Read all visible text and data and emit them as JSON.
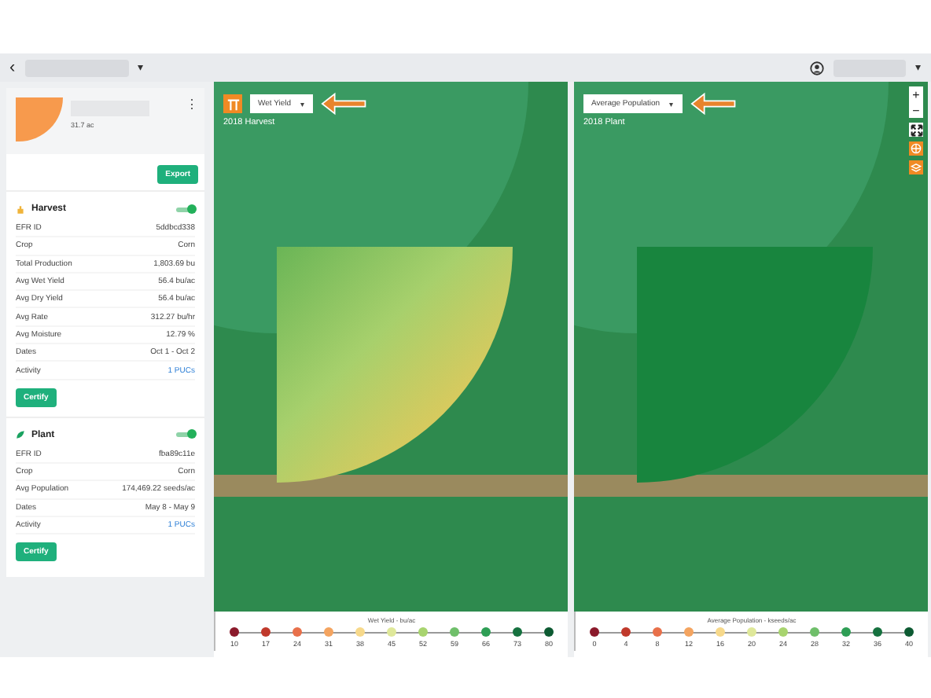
{
  "header": {
    "back": "‹",
    "caret": "▾",
    "user_caret": "▾"
  },
  "field": {
    "area": "31.7 ac",
    "menu": "⋮"
  },
  "export_button": "Export",
  "sections": [
    {
      "kind": "harvest",
      "title": "Harvest",
      "on": true,
      "rows": [
        {
          "label": "EFR ID",
          "value": "5ddbcd338",
          "link": false
        },
        {
          "label": "Crop",
          "value": "Corn",
          "link": false
        },
        {
          "label": "Total Production",
          "value": "1,803.69 bu",
          "link": false
        },
        {
          "label": "Avg Wet Yield",
          "value": "56.4 bu/ac",
          "link": false
        },
        {
          "label": "Avg Dry Yield",
          "value": "56.4 bu/ac",
          "link": false
        },
        {
          "label": "Avg Rate",
          "value": "312.27 bu/hr",
          "link": false
        },
        {
          "label": "Avg Moisture",
          "value": "12.79 %",
          "link": false
        },
        {
          "label": "Dates",
          "value": "Oct 1 - Oct 2",
          "link": false
        },
        {
          "label": "Activity",
          "value": "1 PUCs",
          "link": true
        }
      ],
      "button": "Certify"
    },
    {
      "kind": "plant",
      "title": "Plant",
      "on": true,
      "rows": [
        {
          "label": "EFR ID",
          "value": "fba89c11e",
          "link": false
        },
        {
          "label": "Crop",
          "value": "Corn",
          "link": false
        },
        {
          "label": "Avg Population",
          "value": "174,469.22 seeds/ac",
          "link": false
        },
        {
          "label": "Dates",
          "value": "May 8 - May 9",
          "link": false
        },
        {
          "label": "Activity",
          "value": "1 PUCs",
          "link": true
        }
      ],
      "button": "Certify"
    }
  ],
  "maps": [
    {
      "kind": "harvest",
      "layer": "Wet Yield",
      "caret": "▾",
      "label": "2018 Harvest",
      "legend": {
        "title": "Wet Yield - bu/ac",
        "stops": [
          {
            "value": "10",
            "color": "#8b1a2b"
          },
          {
            "value": "17",
            "color": "#c0392b"
          },
          {
            "value": "24",
            "color": "#e8704a"
          },
          {
            "value": "31",
            "color": "#f4a460"
          },
          {
            "value": "38",
            "color": "#f7d98b"
          },
          {
            "value": "45",
            "color": "#dfe89a"
          },
          {
            "value": "52",
            "color": "#a8d46f"
          },
          {
            "value": "59",
            "color": "#6fbf6a"
          },
          {
            "value": "66",
            "color": "#2e9e55"
          },
          {
            "value": "73",
            "color": "#16713f"
          },
          {
            "value": "80",
            "color": "#0d5a32"
          }
        ]
      }
    },
    {
      "kind": "plant",
      "layer": "Average Population",
      "caret": "▾",
      "label": "2018 Plant",
      "legend": {
        "title": "Average Population - kseeds/ac",
        "stops": [
          {
            "value": "0",
            "color": "#8b1a2b"
          },
          {
            "value": "4",
            "color": "#c0392b"
          },
          {
            "value": "8",
            "color": "#e8704a"
          },
          {
            "value": "12",
            "color": "#f4a460"
          },
          {
            "value": "16",
            "color": "#f7d98b"
          },
          {
            "value": "20",
            "color": "#dfe89a"
          },
          {
            "value": "24",
            "color": "#a8d46f"
          },
          {
            "value": "28",
            "color": "#6fbf6a"
          },
          {
            "value": "32",
            "color": "#2e9e55"
          },
          {
            "value": "36",
            "color": "#16713f"
          },
          {
            "value": "40",
            "color": "#0d5a32"
          }
        ]
      }
    }
  ],
  "zoom": {
    "plus": "+",
    "minus": "−"
  }
}
